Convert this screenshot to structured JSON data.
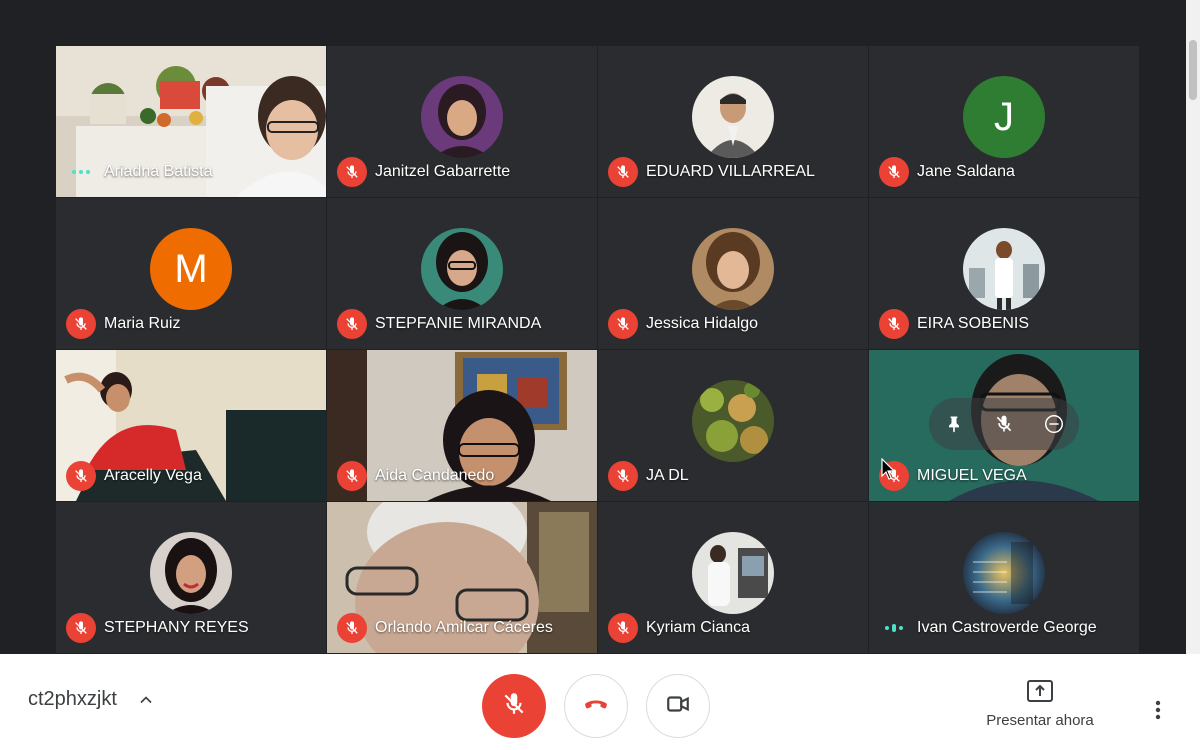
{
  "participants": [
    {
      "name": "Ariadna Batista",
      "status": "speaking"
    },
    {
      "name": "Janitzel Gabarrette",
      "status": "muted"
    },
    {
      "name": "EDUARD VILLARREAL",
      "status": "muted"
    },
    {
      "name": "Jane Saldana",
      "status": "muted",
      "avatar_letter": "J",
      "avatar_color": "#2e7d32"
    },
    {
      "name": "Maria Ruiz",
      "status": "muted",
      "avatar_letter": "M",
      "avatar_color": "#ef6c00"
    },
    {
      "name": "STEPFANIE MIRANDA",
      "status": "muted"
    },
    {
      "name": "Jessica Hidalgo",
      "status": "muted"
    },
    {
      "name": "EIRA SOBENIS",
      "status": "muted"
    },
    {
      "name": "Aracelly Vega",
      "status": "muted"
    },
    {
      "name": "Aida Candanedo",
      "status": "muted"
    },
    {
      "name": "JA DL",
      "status": "muted"
    },
    {
      "name": "MIGUEL VEGA",
      "status": "muted"
    },
    {
      "name": "STEPHANY REYES",
      "status": "muted"
    },
    {
      "name": "Orlando Amilcar Cáceres",
      "status": "muted"
    },
    {
      "name": "Kyriam Cianca",
      "status": "muted"
    },
    {
      "name": "Ivan Castroverde George",
      "status": "speaking"
    }
  ],
  "bottombar": {
    "meeting_code": "ct2phxzjkt",
    "present_label": "Presentar ahora"
  },
  "colors": {
    "accent_speaking": "#4ce0c7",
    "mute_red": "#ea4335",
    "background": "#202124"
  },
  "icons": [
    "mic-off-icon",
    "hang-up-icon",
    "camera-icon",
    "present-icon",
    "more-vert-icon",
    "chevron-up-icon",
    "pin-icon"
  ]
}
